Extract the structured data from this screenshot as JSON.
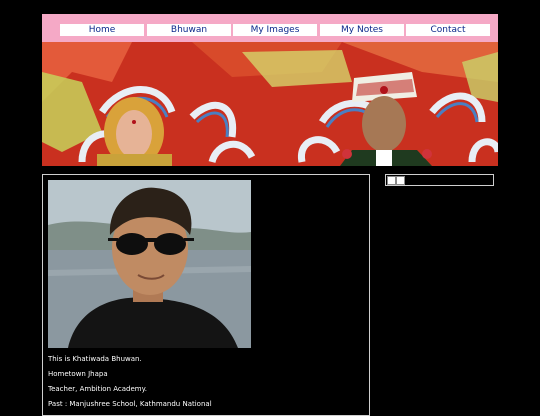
{
  "nav": {
    "items": [
      {
        "label": "Home"
      },
      {
        "label": "Bhuwan"
      },
      {
        "label": "My Images"
      },
      {
        "label": "My Notes"
      },
      {
        "label": "Contact"
      }
    ]
  },
  "colors": {
    "nav_background": "#f5a9c6",
    "nav_text": "#0b2a8c",
    "page_background": "#000000",
    "banner_red": "#c22a1e"
  },
  "bio": {
    "lines": [
      "This is Khatiwada Bhuwan.",
      "Hometown Jhapa",
      "Teacher, Ambition Academy.",
      "Past : Manjushree School, Kathmandu National"
    ]
  },
  "icons": {
    "side_widget": [
      "broken-image-icon",
      "broken-image-icon"
    ]
  }
}
